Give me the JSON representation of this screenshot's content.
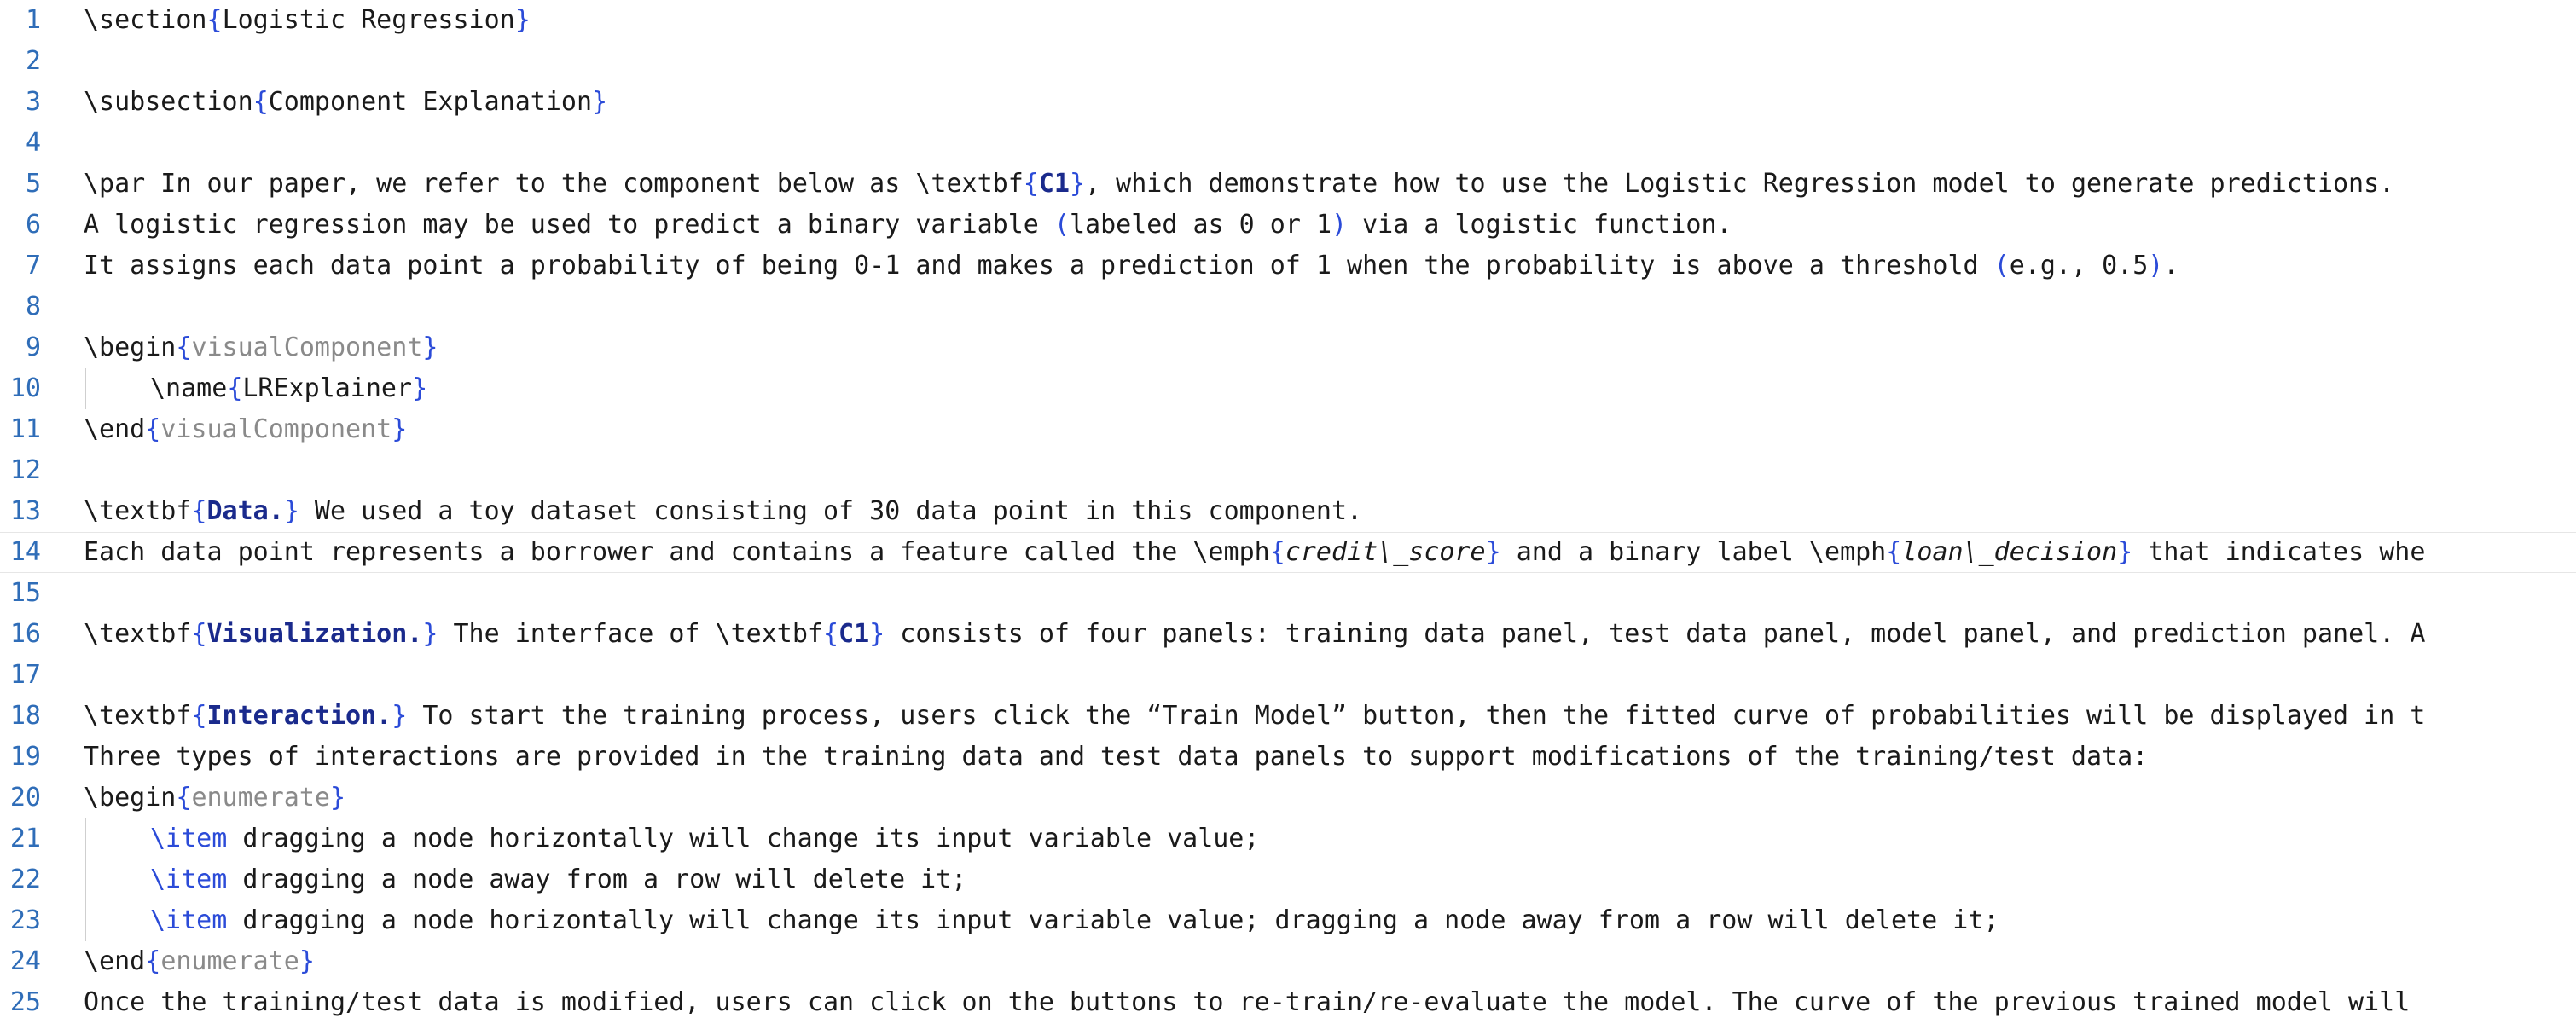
{
  "editor": {
    "lines": [
      {
        "n": "1",
        "parts": [
          {
            "t": "\\section"
          },
          {
            "t": "{",
            "c": "brace"
          },
          {
            "t": "Logistic Regression"
          },
          {
            "t": "}",
            "c": "brace"
          }
        ]
      },
      {
        "n": "2",
        "parts": []
      },
      {
        "n": "3",
        "parts": [
          {
            "t": "\\subsection"
          },
          {
            "t": "{",
            "c": "brace"
          },
          {
            "t": "Component Explanation"
          },
          {
            "t": "}",
            "c": "brace"
          }
        ]
      },
      {
        "n": "4",
        "parts": []
      },
      {
        "n": "5",
        "parts": [
          {
            "t": "\\par In our paper, we refer to the component below as \\textbf"
          },
          {
            "t": "{",
            "c": "brace"
          },
          {
            "t": "C1",
            "c": "bold"
          },
          {
            "t": "}",
            "c": "brace"
          },
          {
            "t": ", which demonstrate how to use the Logistic Regression model to generate predictions."
          }
        ]
      },
      {
        "n": "6",
        "parts": [
          {
            "t": "A logistic regression may be used to predict a binary variable "
          },
          {
            "t": "(",
            "c": "paren"
          },
          {
            "t": "labeled as 0 or 1"
          },
          {
            "t": ")",
            "c": "paren"
          },
          {
            "t": " via a logistic function."
          }
        ]
      },
      {
        "n": "7",
        "parts": [
          {
            "t": "It assigns each data point a probability of being 0-1 and makes a prediction of 1 when the probability is above a threshold "
          },
          {
            "t": "(",
            "c": "paren"
          },
          {
            "t": "e.g., 0.5"
          },
          {
            "t": ")",
            "c": "paren"
          },
          {
            "t": "."
          }
        ]
      },
      {
        "n": "8",
        "parts": []
      },
      {
        "n": "9",
        "parts": [
          {
            "t": "\\begin"
          },
          {
            "t": "{",
            "c": "brace"
          },
          {
            "t": "visualComponent",
            "c": "env"
          },
          {
            "t": "}",
            "c": "brace"
          }
        ]
      },
      {
        "n": "10",
        "indent": true,
        "parts": [
          {
            "t": "\\name"
          },
          {
            "t": "{",
            "c": "brace"
          },
          {
            "t": "LRExplainer"
          },
          {
            "t": "}",
            "c": "brace"
          }
        ]
      },
      {
        "n": "11",
        "parts": [
          {
            "t": "\\end"
          },
          {
            "t": "{",
            "c": "brace"
          },
          {
            "t": "visualComponent",
            "c": "env"
          },
          {
            "t": "}",
            "c": "brace"
          }
        ]
      },
      {
        "n": "12",
        "parts": []
      },
      {
        "n": "13",
        "parts": [
          {
            "t": "\\textbf"
          },
          {
            "t": "{",
            "c": "brace"
          },
          {
            "t": "Data.",
            "c": "bold"
          },
          {
            "t": "}",
            "c": "brace"
          },
          {
            "t": " We used a toy dataset consisting of 30 data point in this component."
          }
        ]
      },
      {
        "n": "14",
        "current": true,
        "parts": [
          {
            "t": "Each data point represents a borrower and contains a feature called the \\emph"
          },
          {
            "t": "{",
            "c": "brace"
          },
          {
            "t": "credit\\_score",
            "c": "ital"
          },
          {
            "t": "}",
            "c": "brace"
          },
          {
            "t": " and a binary label \\emph"
          },
          {
            "t": "{",
            "c": "brace"
          },
          {
            "t": "loan\\_decision",
            "c": "ital"
          },
          {
            "t": "}",
            "c": "brace"
          },
          {
            "t": " that indicates whe"
          }
        ]
      },
      {
        "n": "15",
        "parts": []
      },
      {
        "n": "16",
        "parts": [
          {
            "t": "\\textbf"
          },
          {
            "t": "{",
            "c": "brace"
          },
          {
            "t": "Visualization.",
            "c": "bold"
          },
          {
            "t": "}",
            "c": "brace"
          },
          {
            "t": " The interface of \\textbf"
          },
          {
            "t": "{",
            "c": "brace"
          },
          {
            "t": "C1",
            "c": "bold"
          },
          {
            "t": "}",
            "c": "brace"
          },
          {
            "t": " consists of four panels: training data panel, test data panel, model panel, and prediction panel. A"
          }
        ]
      },
      {
        "n": "17",
        "parts": []
      },
      {
        "n": "18",
        "parts": [
          {
            "t": "\\textbf"
          },
          {
            "t": "{",
            "c": "brace"
          },
          {
            "t": "Interaction.",
            "c": "bold"
          },
          {
            "t": "}",
            "c": "brace"
          },
          {
            "t": " To start the training process, users click the “Train Model” button, then the fitted curve of probabilities will be displayed in t"
          }
        ]
      },
      {
        "n": "19",
        "parts": [
          {
            "t": "Three types of interactions are provided in the training data and test data panels to support modifications of the training/test data:"
          }
        ]
      },
      {
        "n": "20",
        "parts": [
          {
            "t": "\\begin"
          },
          {
            "t": "{",
            "c": "brace"
          },
          {
            "t": "enumerate",
            "c": "env"
          },
          {
            "t": "}",
            "c": "brace"
          }
        ]
      },
      {
        "n": "21",
        "indent": true,
        "parts": [
          {
            "t": "\\item",
            "c": "item"
          },
          {
            "t": " dragging a node horizontally will change its input variable value;"
          }
        ]
      },
      {
        "n": "22",
        "indent": true,
        "parts": [
          {
            "t": "\\item",
            "c": "item"
          },
          {
            "t": " dragging a node away from a row will delete it;"
          }
        ]
      },
      {
        "n": "23",
        "indent": true,
        "parts": [
          {
            "t": "\\item",
            "c": "item"
          },
          {
            "t": " dragging a node horizontally will change its input variable value; dragging a node away from a row will delete it;"
          }
        ]
      },
      {
        "n": "24",
        "parts": [
          {
            "t": "\\end"
          },
          {
            "t": "{",
            "c": "brace"
          },
          {
            "t": "enumerate",
            "c": "env"
          },
          {
            "t": "}",
            "c": "brace"
          }
        ]
      },
      {
        "n": "25",
        "parts": [
          {
            "t": "Once the training/test data is modified, users can click on the buttons to re-train/re-evaluate the model. The curve of the previous trained model will"
          }
        ]
      }
    ]
  }
}
